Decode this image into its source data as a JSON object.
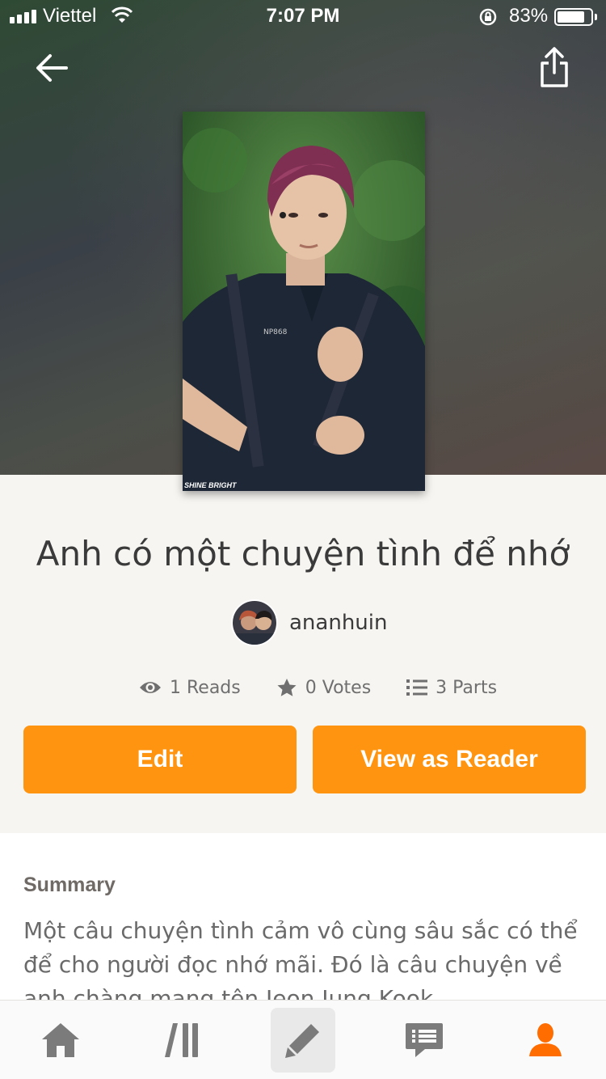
{
  "status_bar": {
    "carrier": "Viettel",
    "time": "7:07 PM",
    "battery_percent": "83%",
    "battery_level": 0.83
  },
  "header": {
    "back_icon": "arrow-left-icon",
    "share_icon": "share-icon"
  },
  "story": {
    "cover_watermark": "SHINE BRIGHT",
    "title": "Anh có một chuyện tình để nhớ",
    "author": "ananhuin",
    "stats": {
      "reads": "1 Reads",
      "votes": "0 Votes",
      "parts": "3 Parts"
    }
  },
  "actions": {
    "edit_label": "Edit",
    "view_as_reader_label": "View as Reader",
    "accent_color": "#ff9410"
  },
  "summary": {
    "label": "Summary",
    "text": "Một câu chuyện tình cảm vô cùng sâu sắc có thể  để cho người đọc nhớ mãi. Đó là câu chuyện về anh chàng mang tên Jeon Jung Kook"
  },
  "tabbar": {
    "items": [
      {
        "icon": "home-icon",
        "active": false
      },
      {
        "icon": "library-icon",
        "active": false
      },
      {
        "icon": "pencil-icon",
        "active": false,
        "selected": true
      },
      {
        "icon": "messages-icon",
        "active": false
      },
      {
        "icon": "profile-icon",
        "active": true
      }
    ],
    "active_color": "#ff6d00"
  }
}
